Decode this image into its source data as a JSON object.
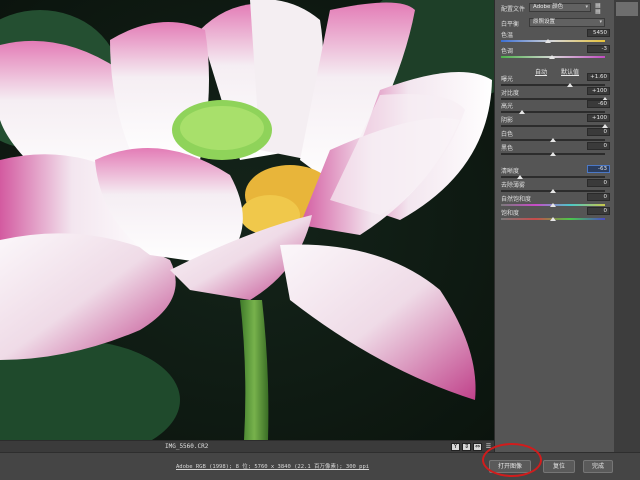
{
  "panel": {
    "profile_label": "配置文件",
    "profile_value": "Adobe 颜色",
    "white_balance_label": "白平衡",
    "white_balance_value": "原照设置",
    "auto_link": "自动",
    "default_link": "默认值",
    "sliders": [
      {
        "id": "temperature",
        "label": "色温",
        "value": "5450",
        "level": 0.45
      },
      {
        "id": "tint",
        "label": "色调",
        "value": "-3",
        "level": 0.49
      },
      {
        "id": "exposure",
        "label": "曝光",
        "value": "+1.60",
        "level": 0.66
      },
      {
        "id": "contrast",
        "label": "对比度",
        "value": "+100",
        "level": 1.0
      },
      {
        "id": "highlights",
        "label": "高光",
        "value": "-60",
        "level": 0.2
      },
      {
        "id": "shadows",
        "label": "阴影",
        "value": "+100",
        "level": 1.0
      },
      {
        "id": "whites",
        "label": "白色",
        "value": "0",
        "level": 0.5
      },
      {
        "id": "blacks",
        "label": "黑色",
        "value": "0",
        "level": 0.5
      },
      {
        "id": "clarity",
        "label": "清晰度",
        "value": "-63",
        "level": 0.18,
        "active": true
      },
      {
        "id": "dehaze",
        "label": "去除薄雾",
        "value": "0",
        "level": 0.5
      },
      {
        "id": "vibrance",
        "label": "自然饱和度",
        "value": "0",
        "level": 0.5
      },
      {
        "id": "saturation",
        "label": "饱和度",
        "value": "0",
        "level": 0.5
      }
    ]
  },
  "filename": "IMG_5560.CR2",
  "view_buttons": [
    "Y",
    "⇕",
    "⇔",
    "☰"
  ],
  "workflow_text": "Adobe RGB (1998); 8 位; 5760 x 3840 (22.1 百万像素); 300 ppi",
  "buttons": {
    "open": "打开图像",
    "reset": "复位",
    "done": "完成"
  },
  "colors": {
    "highlight_circle": "#d11c1c",
    "active_field": "#4b78c6"
  }
}
